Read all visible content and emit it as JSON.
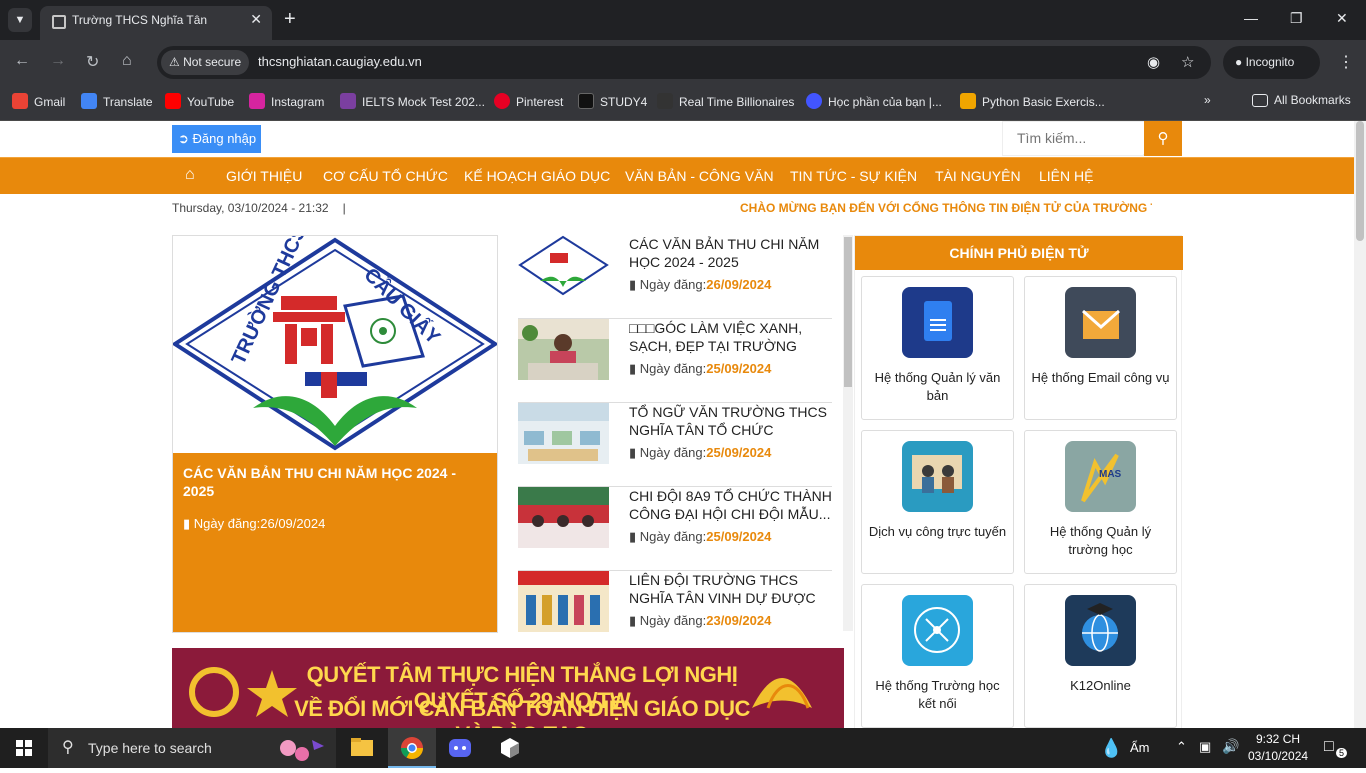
{
  "browser": {
    "tab_title": "Trường THCS Nghĩa Tân",
    "new_tab": "+",
    "security_label": "Not secure",
    "url": "thcsnghiatan.caugiay.edu.vn",
    "incognito_label": "Incognito"
  },
  "bookmarks": [
    {
      "label": "Gmail",
      "color": "#ea4335"
    },
    {
      "label": "Translate",
      "color": "#4285f4"
    },
    {
      "label": "YouTube",
      "color": "#ff0000"
    },
    {
      "label": "Instagram",
      "color": "#d6249f"
    },
    {
      "label": "IELTS Mock Test 202...",
      "color": "#7b3fa0"
    },
    {
      "label": "Pinterest",
      "color": "#e60023"
    },
    {
      "label": "STUDY4",
      "color": "#111111"
    },
    {
      "label": "Real Time Billionaires",
      "color": "#333333"
    },
    {
      "label": "Học phần của bạn |...",
      "color": "#4255ff"
    },
    {
      "label": "Python Basic Exercis...",
      "color": "#f0a500"
    }
  ],
  "all_bookmarks": "All Bookmarks",
  "site": {
    "login_label": "Đăng nhập",
    "search_placeholder": "Tìm kiếm...",
    "menu": [
      "GIỚI THIỆU",
      "CƠ CẤU TỔ CHỨC",
      "KẾ HOẠCH GIÁO DỤC",
      "VĂN BẢN - CÔNG VĂN",
      "TIN TỨC - SỰ KIỆN",
      "TÀI NGUYÊN",
      "LIÊN HỆ"
    ],
    "datetime": "Thursday, 03/10/2024 - 21:32",
    "separator": "|",
    "welcome": "CHÀO MỪNG BẠN ĐẾN VỚI CỔNG THÔNG TIN ĐIỆN TỬ CỦA TRƯỜNG THCS",
    "featured": {
      "logo_text": "TRƯỜNG THCS NGHĨA TÂN - QUẬN CẦU GIẤY",
      "title": "CÁC VĂN BẢN THU CHI NĂM HỌC 2024 - 2025",
      "date": "Ngày đăng:26/09/2024"
    },
    "date_prefix": "Ngày đăng:",
    "news": [
      {
        "title": "CÁC VĂN BẢN THU CHI NĂM HỌC 2024 - 2025",
        "date": "26/09/2024"
      },
      {
        "title": "□□□GÓC LÀM VIỆC XANH, SẠCH, ĐẸP TẠI TRƯỜNG THC...",
        "date": "25/09/2024"
      },
      {
        "title": "TỔ NGỮ VĂN TRƯỜNG THCS NGHĨA TÂN TỔ CHỨC THÀNH...",
        "date": "25/09/2024"
      },
      {
        "title": "CHI ĐỘI 8A9 TỔ CHỨC THÀNH CÔNG ĐẠI HỘI CHI ĐỘI MẪU...",
        "date": "25/09/2024"
      },
      {
        "title": "LIÊN ĐỘI TRƯỜNG THCS NGHĨA TÂN VINH DỰ ĐƯỢC KHEN...",
        "date": "23/09/2024"
      }
    ],
    "gov_title": "CHÍNH PHỦ ĐIỆN TỬ",
    "gov_cards": [
      {
        "label": "Hệ thống Quản lý văn bản",
        "icon": "document-icon",
        "color": "#1e3a8a"
      },
      {
        "label": "Hệ thống Email công vụ",
        "icon": "email-icon",
        "color": "#3f4a5a"
      },
      {
        "label": "Dịch vụ công trực tuyến",
        "icon": "handshake-icon",
        "color": "#2a9bc1"
      },
      {
        "label": "Hệ thống Quản lý trường học",
        "icon": "smas-icon",
        "color": "#8aa6a3"
      },
      {
        "label": "Hệ thống Trường học kết nối",
        "icon": "circuit-icon",
        "color": "#29a6dc"
      },
      {
        "label": "K12Online",
        "icon": "globe-icon",
        "color": "#1e3a5a"
      }
    ],
    "banner_line1": "QUYẾT TÂM THỰC HIỆN THẮNG LỢI NGHỊ QUYẾT SỐ 29-NQ/TW",
    "banner_line2": "VỀ ĐỔI MỚI CĂN BẢN TOÀN DIỆN GIÁO DỤC VÀ ĐÀO TẠO"
  },
  "taskbar": {
    "search_placeholder": "Type here to search",
    "weather": "Ẩm",
    "time": "9:32 CH",
    "date": "03/10/2024",
    "notifications": "5"
  },
  "colors": {
    "accent": "#e8890c",
    "login": "#3a8ef6"
  }
}
